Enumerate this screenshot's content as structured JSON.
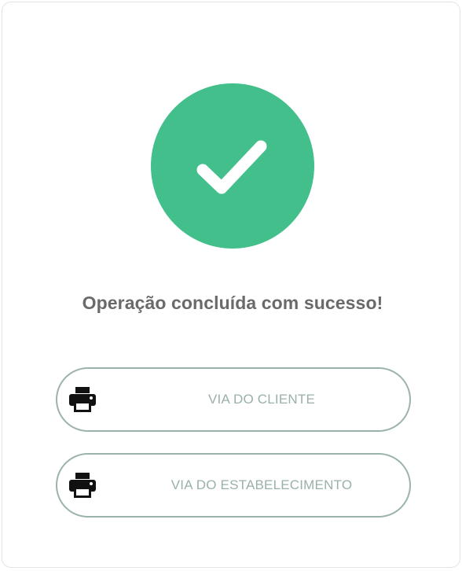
{
  "status": {
    "icon": "check-icon",
    "color": "#43bf8c",
    "message": "Operação concluída com sucesso!"
  },
  "actions": [
    {
      "label": "VIA DO CLIENTE",
      "icon": "printer-icon"
    },
    {
      "label": "VIA DO ESTABELECIMENTO",
      "icon": "printer-icon"
    }
  ],
  "colors": {
    "button_border": "#9bb3ad",
    "button_text": "#9ab0ab",
    "message_text": "#6a6a6a"
  }
}
